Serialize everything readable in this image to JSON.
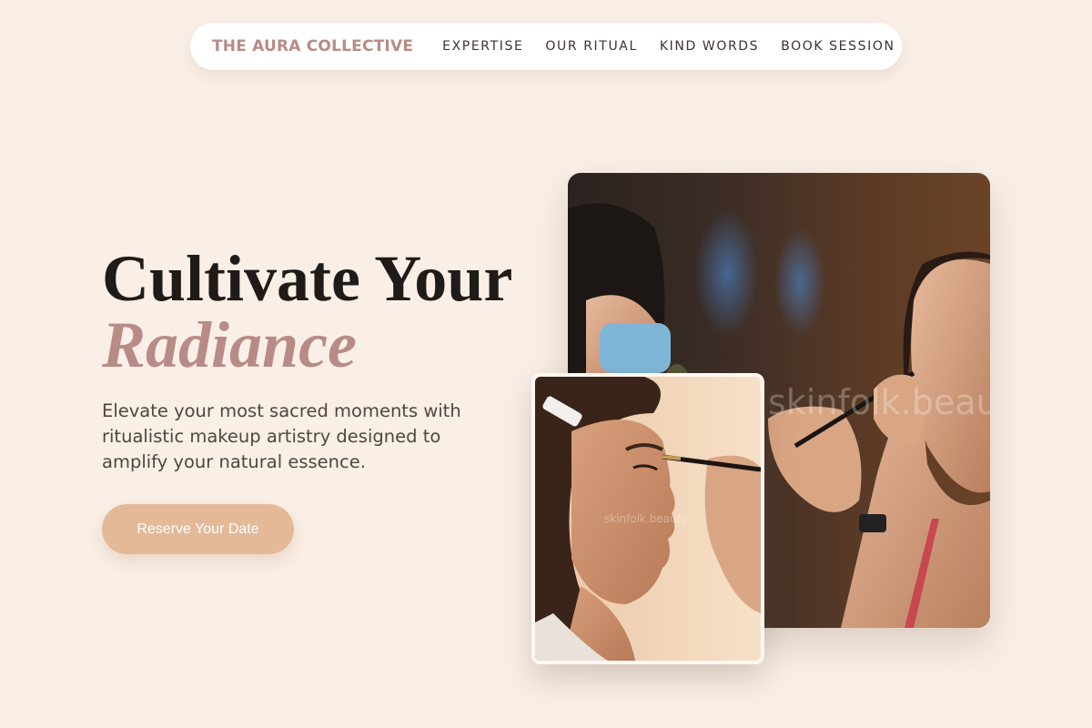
{
  "nav": {
    "brand": "THE AURA COLLECTIVE",
    "links": [
      "EXPERTISE",
      "OUR RITUAL",
      "KIND WORDS",
      "BOOK SESSION"
    ]
  },
  "hero": {
    "headline_line1": "Cultivate Your",
    "headline_line2": "Radiance",
    "subtext": "Elevate your most sacred moments with ritualistic makeup artistry designed to amplify your natural essence.",
    "cta_label": "Reserve Your Date"
  },
  "images": {
    "main_watermark": "skinfolk.beauty",
    "small_watermark": "skinfolk.beauty"
  },
  "colors": {
    "background": "#f9efe6",
    "accent_rose": "#b88b86",
    "cta": "#e3b998",
    "nav_bg": "#ffffff"
  }
}
